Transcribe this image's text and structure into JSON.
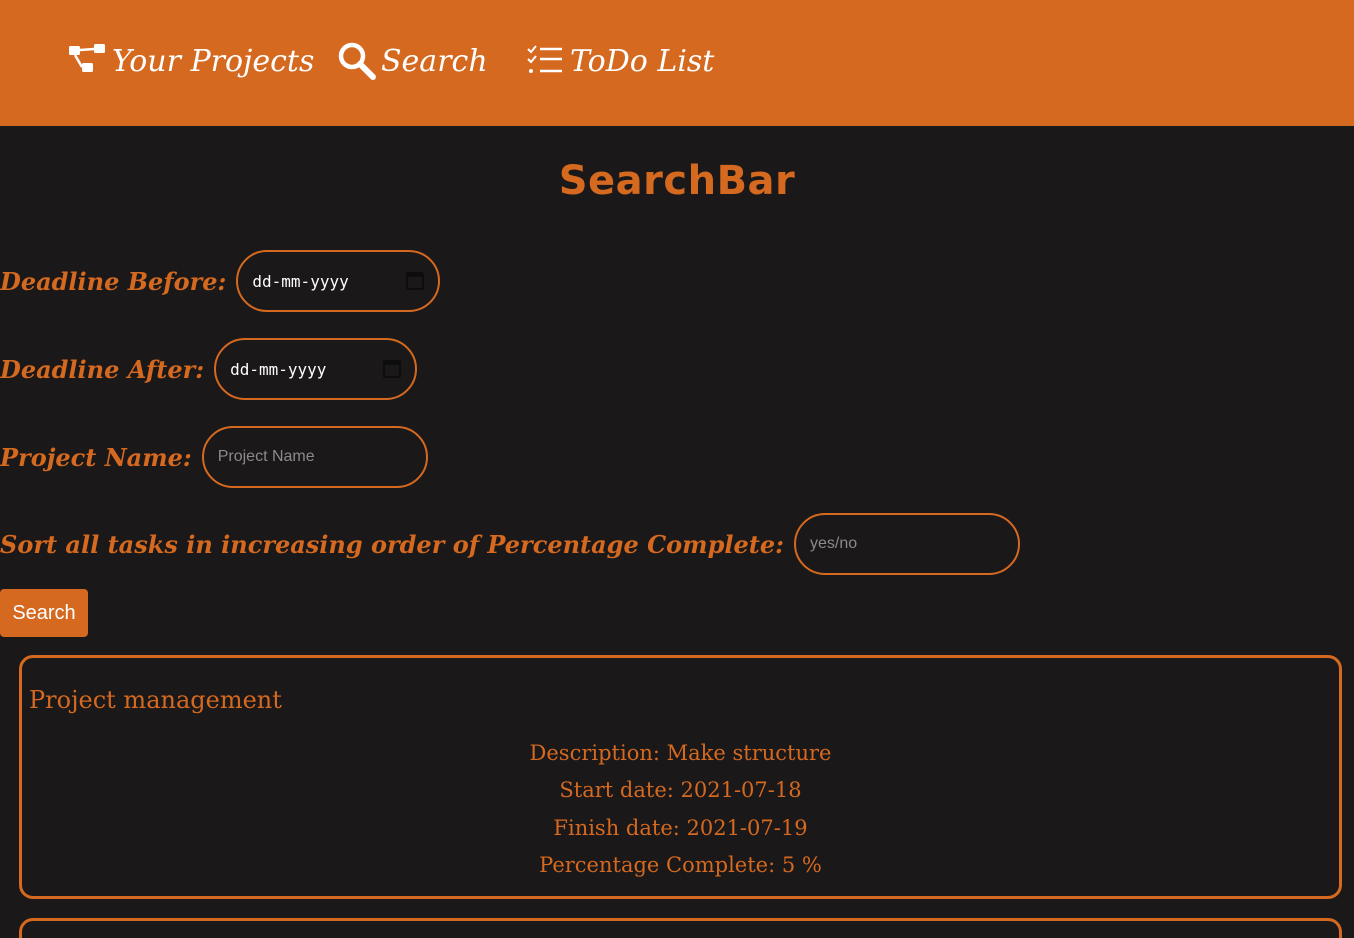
{
  "nav": {
    "items": [
      {
        "label": "Your Projects",
        "icon": "project-tree-icon"
      },
      {
        "label": "Search",
        "icon": "search-icon"
      },
      {
        "label": "ToDo List",
        "icon": "todo-list-icon"
      }
    ]
  },
  "page": {
    "title": "SearchBar"
  },
  "form": {
    "deadline_before": {
      "label": "Deadline Before:",
      "value": "dd-mm-yyyy"
    },
    "deadline_after": {
      "label": "Deadline After:",
      "value": "dd-mm-yyyy"
    },
    "project_name": {
      "label": "Project Name:",
      "placeholder": "Project Name"
    },
    "sort": {
      "label": "Sort all tasks in increasing order of Percentage Complete:",
      "placeholder": "yes/no"
    },
    "search_button": "Search"
  },
  "results": [
    {
      "title": "Project management",
      "description": "Description: Make structure",
      "start": "Start date: 2021-07-18",
      "finish": "Finish date: 2021-07-19",
      "percent": "Percentage Complete: 5 %"
    }
  ],
  "colors": {
    "accent": "#d4691f",
    "background": "#1b1819",
    "nav_text": "#ffffff"
  }
}
